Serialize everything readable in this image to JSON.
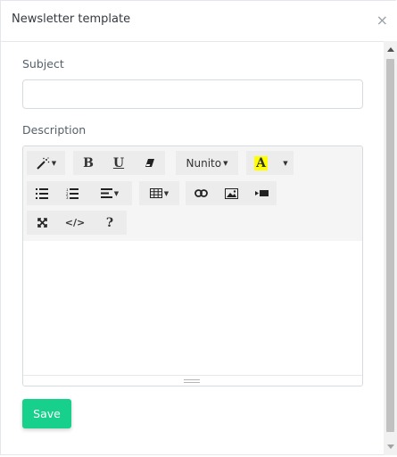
{
  "modal": {
    "title": "Newsletter template",
    "close_label": "×"
  },
  "form": {
    "subject_label": "Subject",
    "subject_value": "",
    "description_label": "Description",
    "save_label": "Save"
  },
  "editor": {
    "toolbar": {
      "style_button": {
        "icon": "magic-wand-icon"
      },
      "bold": {
        "label": "B"
      },
      "underline": {
        "label": "U"
      },
      "clear_format": {
        "icon": "eraser-icon"
      },
      "font_name": {
        "label": "Nunito"
      },
      "font_color": {
        "label": "A",
        "highlight_color": "#ffff00"
      },
      "unordered_list": {
        "icon": "unordered-list-icon"
      },
      "ordered_list": {
        "icon": "ordered-list-icon"
      },
      "paragraph": {
        "icon": "align-left-icon"
      },
      "table": {
        "icon": "table-icon"
      },
      "link": {
        "icon": "link-icon"
      },
      "picture": {
        "icon": "picture-icon"
      },
      "video": {
        "icon": "video-icon"
      },
      "fullscreen": {
        "icon": "fullscreen-icon"
      },
      "codeview": {
        "label": "</>"
      },
      "help": {
        "label": "?"
      }
    },
    "content": ""
  },
  "colors": {
    "save_button": "#17d08b",
    "toolbar_bg": "#f5f5f5"
  }
}
